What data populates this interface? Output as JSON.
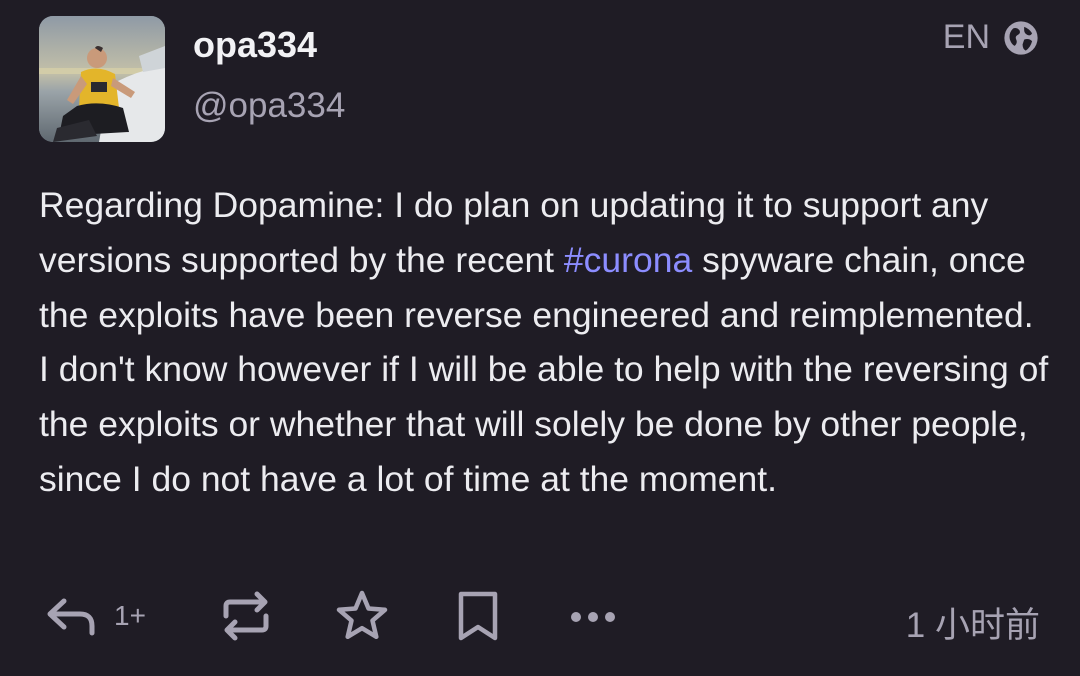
{
  "account": {
    "display_name": "opa334",
    "handle": "@opa334"
  },
  "language": {
    "code": "EN",
    "icon": "globe-icon"
  },
  "post": {
    "text_before_tag": "Regarding Dopamine: I do plan on updating it to support any versions supported by the recent ",
    "hashtag": "#curona",
    "text_after_tag": " spyware chain, once the exploits have been reverse engineered and reimplemented. I don't know however if I will be able to help with the reversing of the exploits or whether that will solely be done by other people, since I do not have a lot of time at the moment."
  },
  "actions": {
    "reply_icon": "reply-icon",
    "reply_count": "1+",
    "boost_icon": "boost-icon",
    "favourite_icon": "star-icon",
    "bookmark_icon": "bookmark-icon",
    "more_icon": "more-icon",
    "timestamp": "1 小时前"
  },
  "colors": {
    "background": "#1f1c25",
    "text": "#ececf0",
    "secondary_text": "#a7a3b3",
    "hashtag": "#8c8dff"
  }
}
